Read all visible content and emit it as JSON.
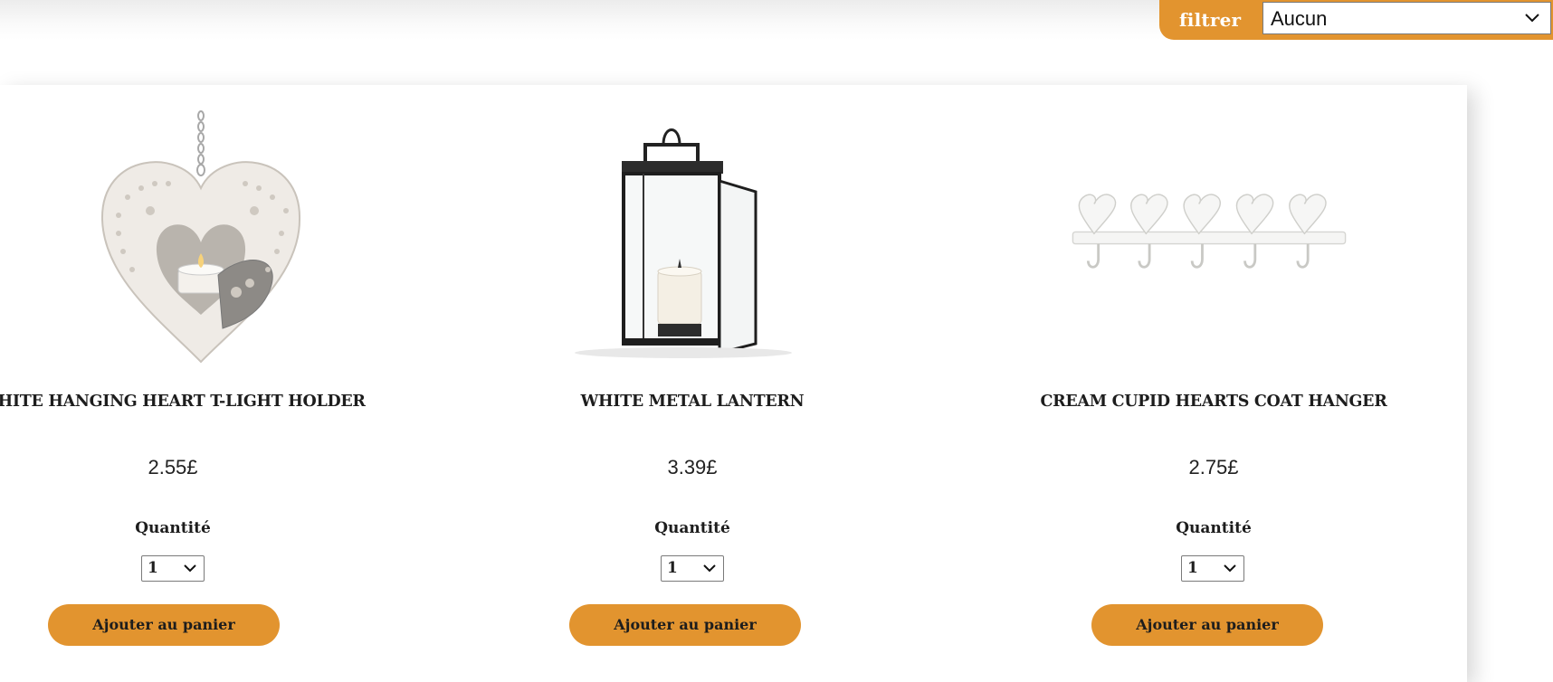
{
  "filter": {
    "label": "filtrer",
    "selected": "Aucun"
  },
  "products": [
    {
      "name": "WHITE HANGING HEART T-LIGHT HOLDER",
      "price": "2.55£",
      "quantity_label": "Quantité",
      "quantity": "1",
      "button_label": "Ajouter au panier"
    },
    {
      "name": "WHITE METAL LANTERN",
      "price": "3.39£",
      "quantity_label": "Quantité",
      "quantity": "1",
      "button_label": "Ajouter au panier"
    },
    {
      "name": "CREAM CUPID HEARTS COAT HANGER",
      "price": "2.75£",
      "quantity_label": "Quantité",
      "quantity": "1",
      "button_label": "Ajouter au panier"
    }
  ],
  "colors": {
    "accent": "#e2942f",
    "text": "#1d1d1d"
  }
}
